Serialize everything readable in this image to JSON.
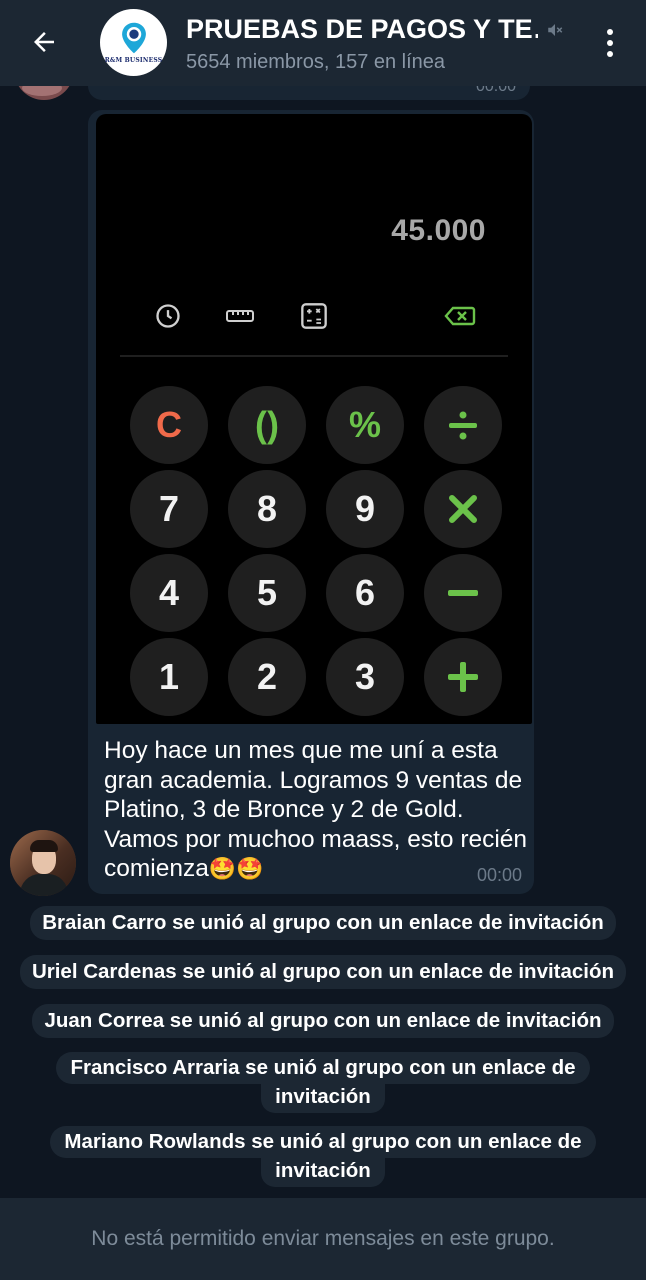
{
  "header": {
    "title": "PRUEBAS DE PAGOS Y TE…",
    "subtitle": "5654 miembros, 157 en línea",
    "avatar_brand": "R&M BUSINESS",
    "back_icon": "arrow-left-icon",
    "mute_icon": "muted-speaker-icon",
    "menu_icon": "more-vertical-icon"
  },
  "previous_message": {
    "time": "00:00"
  },
  "message": {
    "photo": {
      "display_value": "45.000",
      "toolbar_icons": [
        "history-icon",
        "ruler-icon",
        "scientific-icon",
        "backspace-icon"
      ],
      "keys": [
        [
          "C",
          "()",
          "%",
          "÷"
        ],
        [
          "7",
          "8",
          "9",
          "×"
        ],
        [
          "4",
          "5",
          "6",
          "−"
        ],
        [
          "1",
          "2",
          "3",
          "+"
        ]
      ]
    },
    "lines": [
      "Hoy hace un mes que me uní a esta",
      "gran academia. Logramos 9 ventas de",
      "Platino, 3 de Bronce y 2 de Gold.",
      "Vamos por muchoo maass, esto recién",
      "comienza"
    ],
    "emoji": "🤩🤩",
    "time": "00:00"
  },
  "service_messages": [
    "Braian Carro se unió al grupo con un enlace de invitación",
    "Uriel Cardenas se unió al grupo con un enlace de invitación",
    "Juan Correa se unió al grupo con un enlace de invitación",
    [
      "Francisco Arraria se unió al grupo con un enlace de",
      "invitación"
    ],
    [
      "Mariano Rowlands se unió al grupo con un enlace de",
      "invitación"
    ]
  ],
  "footer": {
    "note": "No está permitido enviar mensajes en este grupo."
  },
  "colors": {
    "background": "#0e1621",
    "header": "#1c2733",
    "bubble": "#182533",
    "clear_key": "#f06a4a",
    "operator_key": "#6bc24a"
  }
}
